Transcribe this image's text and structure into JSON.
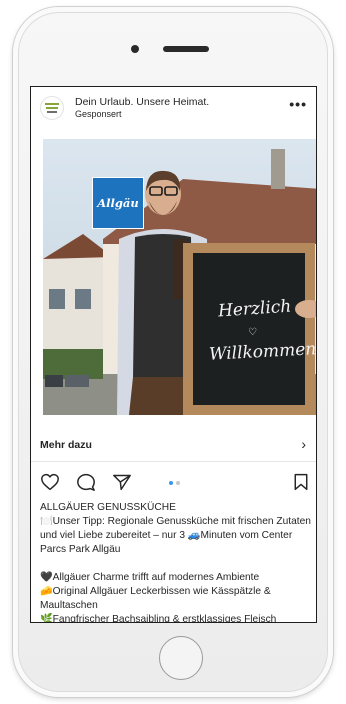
{
  "post": {
    "account_name": "Dein Urlaub. Unsere Heimat.",
    "sponsored_label": "Gesponsert",
    "more_icon": "more-horizontal-icon",
    "brand_logo_text": "Allgäu",
    "sign_line1": "Herzlich",
    "sign_line2": "Willkommen",
    "cta_label": "Mehr dazu",
    "carousel": {
      "count": 2,
      "active_index": 0
    },
    "caption": {
      "title": "ALLGÄUER GENUSSKÜCHE",
      "line_tip": "🍽️Unser Tipp: Regionale Genussküche mit frischen Zutaten und viel Liebe zubereitet – nur 3 🚙Minuten vom Center Parcs Park Allgäu",
      "line_charme": "🖤Allgäuer Charme trifft auf modernes Ambiente",
      "line_original": "🧀Original Allgäuer Leckerbissen wie Kässpätzle & Maultaschen",
      "line_fisch": "🌿Fangfrischer Bachsaibling & erstklassiges Fleisch"
    }
  },
  "colors": {
    "accent": "#3897f0",
    "brand_blue": "#1e73be",
    "text": "#262626"
  }
}
